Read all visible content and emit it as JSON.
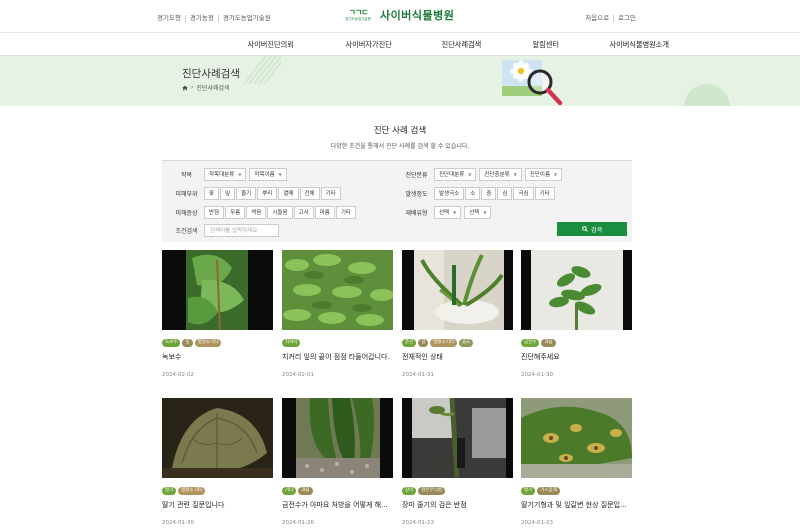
{
  "util_left": [
    "경기도청",
    "경기농정",
    "경기도농업기술원"
  ],
  "util_right": [
    "처음으로",
    "로그인"
  ],
  "logo": {
    "mark": "ㄱㄱㄷ",
    "sub": "경기도농업기술원",
    "title": "사이버식물병원"
  },
  "gnb": [
    "사이버진단의뢰",
    "사이버자가진단",
    "진단사례검색",
    "알림센터",
    "사이버식물병원소개"
  ],
  "banner": {
    "title": "진단사례검색",
    "breadcrumb": "진단사례검색"
  },
  "section": {
    "title": "진단 사례 검색",
    "desc": "다양한 조건을 통해서 진단 사례를 검색 할 수 있습니다."
  },
  "filter": {
    "crop": {
      "label": "작목",
      "select1": "작목대분류",
      "select2": "작목이름"
    },
    "diag": {
      "label": "진단분류",
      "select1": "진단대분류",
      "select2": "진단중분류",
      "select3": "진단이름"
    },
    "part": {
      "label": "피해부위",
      "chips": [
        "꽃",
        "잎",
        "줄기",
        "뿌리",
        "열매",
        "전체",
        "기타"
      ]
    },
    "degree": {
      "label": "발생정도",
      "chips": [
        "발생극소",
        "소",
        "중",
        "심",
        "극심",
        "기타"
      ]
    },
    "symptom": {
      "label": "피해증상",
      "chips": [
        "반점",
        "무름",
        "썩음",
        "시들음",
        "고사",
        "마름",
        "기타"
      ]
    },
    "type": {
      "label": "재배유형",
      "select1": "선택",
      "select2": "선택"
    },
    "keyword": {
      "label": "조건검색",
      "placeholder": "검색어를 입력하세요"
    },
    "button": "검색"
  },
  "cards": [
    {
      "tags": [
        {
          "t": "녹보수",
          "c": "#6ea53a"
        },
        {
          "t": "잎",
          "c": "#9a8a58"
        },
        {
          "t": "병원소기타",
          "c": "#b0945e"
        }
      ],
      "title": "녹보수",
      "date": "2024-02-02"
    },
    {
      "tags": [
        {
          "t": "치커리",
          "c": "#6ea53a"
        }
      ],
      "title": "치커리 잎의 끝이 점점 타들어갑니다.",
      "date": "2024-02-01"
    },
    {
      "tags": [
        {
          "t": "춘란",
          "c": "#6ea53a"
        },
        {
          "t": "잎",
          "c": "#9a8a58"
        },
        {
          "t": "병원소기타",
          "c": "#b0945e"
        },
        {
          "t": "습도",
          "c": "#8a9a58"
        }
      ],
      "title": "전체적인 상태",
      "date": "2024-01-31"
    },
    {
      "tags": [
        {
          "t": "금전수",
          "c": "#6ea53a"
        },
        {
          "t": "과습",
          "c": "#9a8a58"
        }
      ],
      "title": "진단해주세요",
      "date": "2024-01-30"
    },
    {
      "tags": [
        {
          "t": "딸기",
          "c": "#6ea53a"
        },
        {
          "t": "병원소기타",
          "c": "#b0945e"
        }
      ],
      "title": "딸기 관련 질문입니다",
      "date": "2024-01-30"
    },
    {
      "tags": [
        {
          "t": "기타",
          "c": "#6ea53a"
        },
        {
          "t": "과습",
          "c": "#9a8a58"
        }
      ],
      "title": "금전수가 아파요 처방을 어떻게 해...",
      "date": "2024-01-26"
    },
    {
      "tags": [
        {
          "t": "장미",
          "c": "#6ea53a"
        },
        {
          "t": "검은무늬병",
          "c": "#9a8a58"
        }
      ],
      "title": "장미 줄기의 검은 반점",
      "date": "2024-01-23"
    },
    {
      "tags": [
        {
          "t": "딸기",
          "c": "#6ea53a"
        },
        {
          "t": "가스장해",
          "c": "#9a8a58"
        }
      ],
      "title": "딸기기형과 및 잎갈변 현상 질문입...",
      "date": "2024-01-23"
    }
  ]
}
